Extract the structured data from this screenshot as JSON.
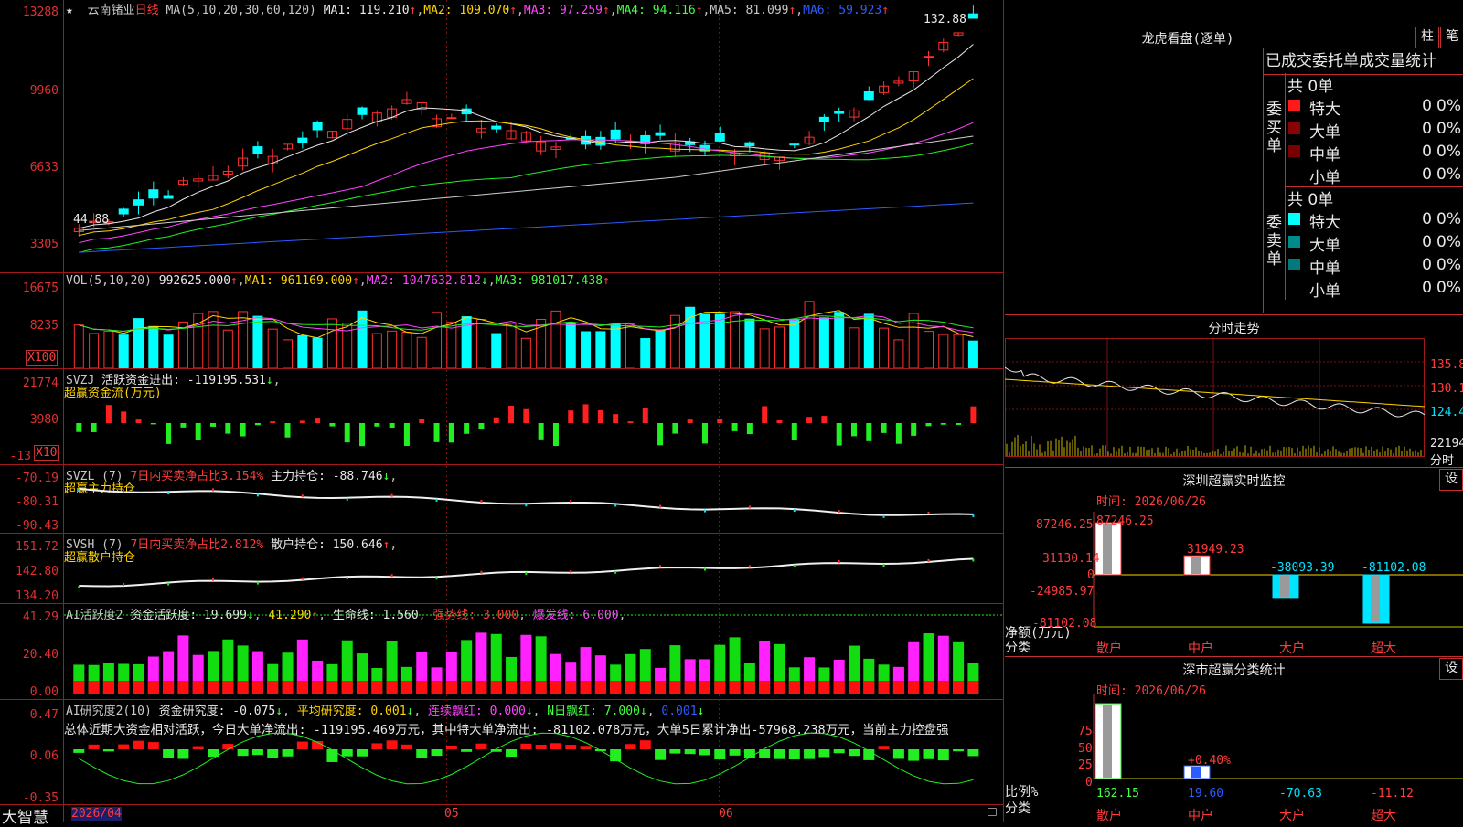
{
  "stock": {
    "name": "云南锗业",
    "period": "日线",
    "star": "★"
  },
  "ma_header": {
    "params": "MA(5,10,20,30,60,120)",
    "ma1": "MA1: 119.210",
    "ma2": "MA2: 109.070",
    "ma3": "MA3: 97.259",
    "ma4": "MA4: 94.116",
    "ma5": "MA5: 81.099",
    "ma6": "MA6: 59.923",
    "arrow": "↑"
  },
  "price_axis": [
    "13288",
    "9960",
    "6633",
    "3305"
  ],
  "price_axis_colors": {
    "main": "#e03030"
  },
  "price_labels": {
    "high": "132.88",
    "low": "44.88"
  },
  "candles": {
    "count": 61,
    "first": 46,
    "last": 128,
    "colors": {
      "up": "#ff3030",
      "down": "#00ffff"
    }
  },
  "ma_colors": {
    "ma1": "#e8e8e8",
    "ma2": "#ffd400",
    "ma3": "#ff44ff",
    "ma4": "#22ee22",
    "ma5": "#cfcfcf",
    "ma6": "#2b5cff"
  },
  "vol": {
    "header": "VOL(5,10,20)",
    "value": "992625.000",
    "ma1": "MA1: 961169.000",
    "ma2": "MA2: 1047632.812",
    "ma3": "MA3: 981017.438",
    "axis": [
      "16675",
      "8235"
    ],
    "unit": "X100"
  },
  "svzj": {
    "header": "SVZJ",
    "label": "活跃资金进出: -119195.531",
    "sub": "超赢资金流(万元)",
    "axis": [
      "21774",
      "3980",
      "-13"
    ],
    "unit": "X10"
  },
  "svzl": {
    "header": "SVZL (7)",
    "ratio": "7日内买卖净占比3.154%",
    "hold": "主力持仓: -88.746",
    "sub": "超赢主力持仓",
    "axis": [
      "-70.19",
      "-80.31",
      "-90.43"
    ]
  },
  "svsh": {
    "header": "SVSH (7)",
    "ratio": "7日内买卖净占比2.812%",
    "hold": "散户持仓: 150.646",
    "sub": "超赢散户持仓",
    "axis": [
      "151.72",
      "142.80",
      "134.20"
    ]
  },
  "ai1": {
    "header": "AI活跃度2",
    "a": "资金活跃度: 19.699",
    "b": "41.290",
    "c": "生命线: 1.560",
    "d": "强势线: 3.000",
    "e": "爆发线: 6.000",
    "axis": [
      "41.29",
      "20.40",
      "0.00"
    ]
  },
  "ai2": {
    "header": "AI研究度2(10)",
    "a": "资金研究度: -0.075",
    "b": "平均研究度: 0.001",
    "c": "连续飘红: 0.000",
    "d": "N日飘红: 7.000",
    "e": "0.001",
    "axis": [
      "0.47",
      "0.06",
      "-0.35"
    ],
    "summary": "总体近期大资金相对活跃，今日大单净流出: -119195.469万元，其中特大单净流出: -81102.078万元，大单5日累计净出-57968.238万元，当前主力控盘强"
  },
  "date_axis": {
    "start": "2026/04",
    "m5": "05",
    "m6": "06"
  },
  "brand": "大智慧",
  "right": {
    "lhb_title": "龙虎看盘(逐单)",
    "btn_bar": "柱",
    "btn_pen": "笔",
    "tabs": "已成交委托单成交量统计",
    "buy": {
      "label": "委买单",
      "total": "共 0单",
      "rows": [
        {
          "n": "特大",
          "v": "0",
          "p": "0%",
          "c": "#ff1a1a"
        },
        {
          "n": "大单",
          "v": "0",
          "p": "0%",
          "c": "#8b0000"
        },
        {
          "n": "中单",
          "v": "0",
          "p": "0%",
          "c": "#7a0000"
        },
        {
          "n": "小单",
          "v": "0",
          "p": "0%",
          "c": "#000000"
        }
      ]
    },
    "sell": {
      "label": "委卖单",
      "total": "共 0单",
      "rows": [
        {
          "n": "特大",
          "v": "0",
          "p": "0%",
          "c": "#00ffff"
        },
        {
          "n": "大单",
          "v": "0",
          "p": "0%",
          "c": "#008b8b"
        },
        {
          "n": "中单",
          "v": "0",
          "p": "0%",
          "c": "#007a7a"
        },
        {
          "n": "小单",
          "v": "0",
          "p": "0%",
          "c": "#000000"
        }
      ]
    },
    "intraday": {
      "title": "分时走势",
      "axis": [
        "135.8",
        "130.1",
        "124.4"
      ],
      "vol": "22194",
      "foot": "分时"
    },
    "sz": {
      "title": "深圳超赢实时监控",
      "btn": "设",
      "time": "时间: 2026/06/26",
      "axis": [
        "87246.25",
        "31130.14",
        "0",
        "-24985.97",
        "-81102.08"
      ],
      "ylabel": "净额(万元)",
      "xlabel": "分类",
      "bars": [
        {
          "cat": "散户",
          "v": "87246.25",
          "val": 87246.25
        },
        {
          "cat": "中户",
          "v": "31949.23",
          "val": 31949.23
        },
        {
          "cat": "大户",
          "v": "-38093.39",
          "val": -38093.39
        },
        {
          "cat": "超大",
          "v": "-81102.08",
          "val": -81102.08
        }
      ]
    },
    "cls": {
      "title": "深市超赢分类统计",
      "btn": "设",
      "time": "时间: 2026/06/26",
      "axis": [
        "75",
        "50",
        "25",
        "0"
      ],
      "ylabel": "比例%",
      "xlabel": "分类",
      "pct": "+0.40%",
      "vals": [
        {
          "cat": "散户",
          "v": "162.15"
        },
        {
          "cat": "中户",
          "v": "19.60"
        },
        {
          "cat": "大户",
          "v": "-70.63"
        },
        {
          "cat": "超大",
          "v": "-11.12"
        }
      ]
    }
  }
}
